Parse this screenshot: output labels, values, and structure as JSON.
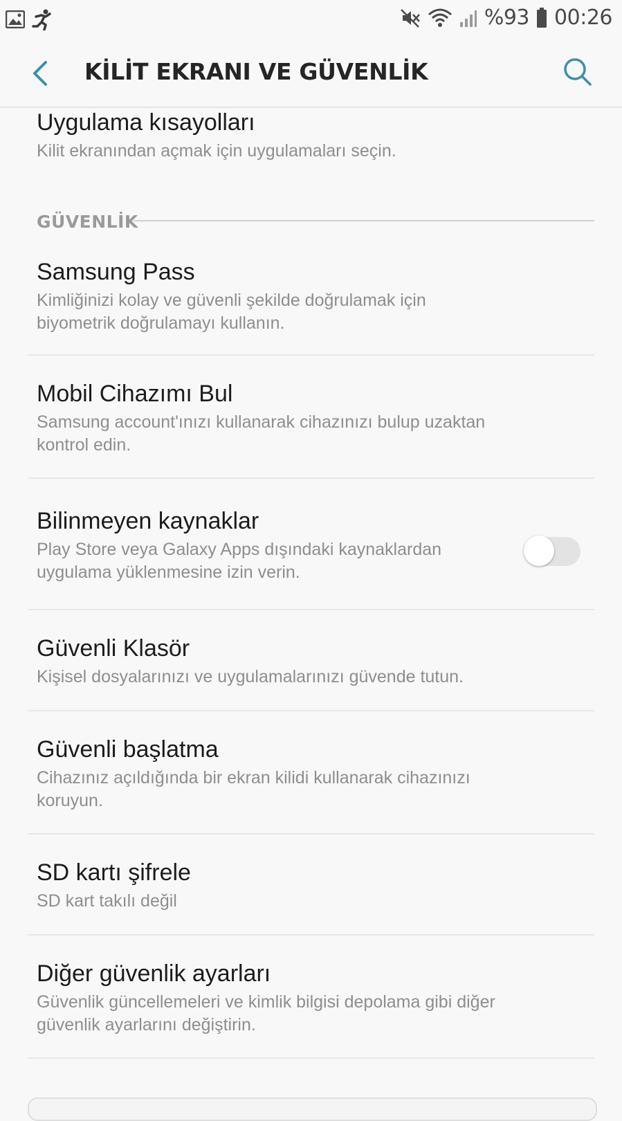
{
  "status_bar": {
    "left_icons": [
      "gallery-icon",
      "runner-icon"
    ],
    "right_icons": [
      "mute-icon",
      "wifi-icon",
      "signal-icon",
      "battery-icon"
    ],
    "battery": "%93",
    "time": "00:26"
  },
  "app_bar": {
    "title": "KİLİT EKRANI VE GÜVENLİK",
    "back_icon": "chevron-left-icon",
    "search_icon": "search-icon",
    "accent_color": "#3b8fb0"
  },
  "items_top": [
    {
      "title": "Uygulama kısayolları",
      "subtitle": "Kilit ekranından açmak için uygulamaları seçin."
    }
  ],
  "section": {
    "label": "GÜVENLİK"
  },
  "items": [
    {
      "title": "Samsung Pass",
      "subtitle_line1": "Kimliğinizi kolay ve güvenli şekilde doğrulamak için",
      "subtitle_line2": "biyometrik doğrulamayı kullanın."
    },
    {
      "title": "Mobil Cihazımı Bul",
      "subtitle_line1": "Samsung account'ınızı kullanarak cihazınızı bulup uzaktan",
      "subtitle_line2": "kontrol edin."
    },
    {
      "title": "Bilinmeyen kaynaklar",
      "subtitle_line1": "Play Store veya Galaxy Apps dışındaki kaynaklardan",
      "subtitle_line2": "uygulama yüklenmesine izin verin.",
      "toggle_on": false
    },
    {
      "title": "Güvenli Klasör",
      "subtitle_line1": "Kişisel dosyalarınızı ve uygulamalarınızı güvende tutun."
    },
    {
      "title": "Güvenli başlatma",
      "subtitle_line1": "Cihazınız açıldığında bir ekran kilidi kullanarak cihazınızı",
      "subtitle_line2": "koruyun."
    },
    {
      "title": "SD kartı şifrele",
      "subtitle_line1": "SD kart takılı değil"
    },
    {
      "title": "Diğer güvenlik ayarları",
      "subtitle_line1": "Güvenlik güncellemeleri ve kimlik bilgisi depolama gibi diğer",
      "subtitle_line2": "güvenlik ayarlarını değiştirin."
    }
  ]
}
